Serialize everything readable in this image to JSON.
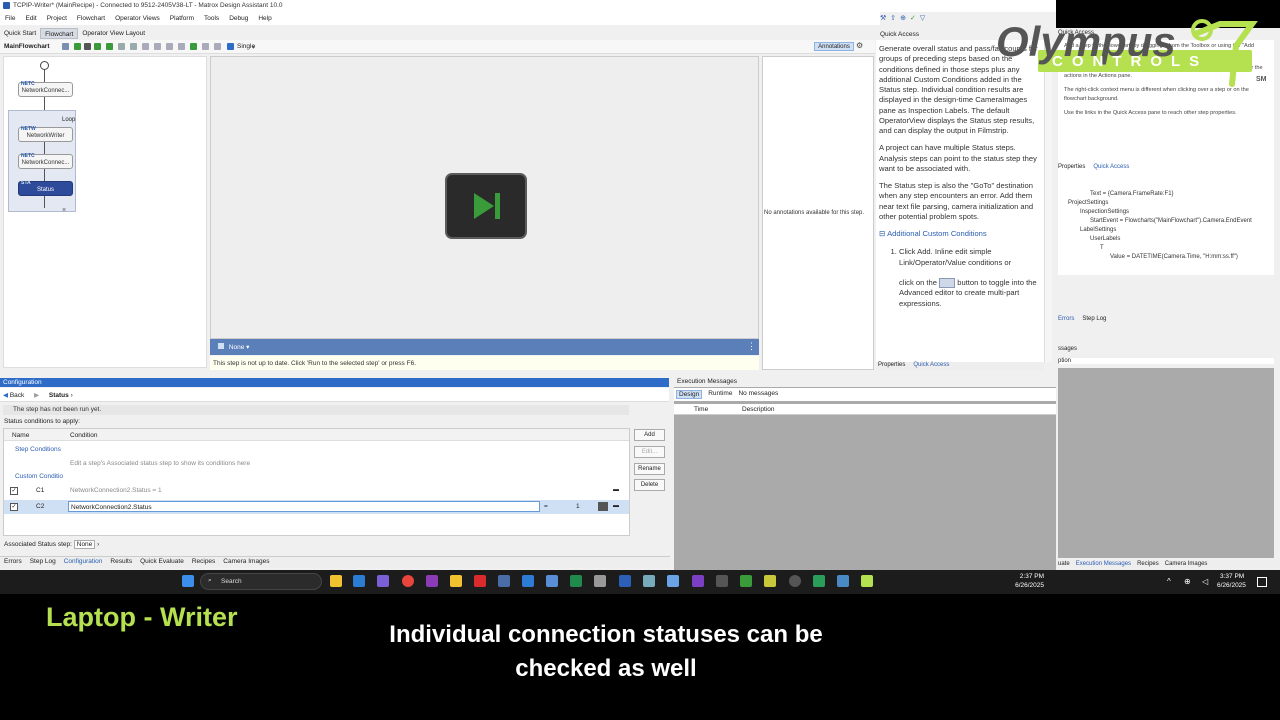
{
  "titlebar": {
    "title": "TCPIP-Writer* (MainRecipe) - Connected to 9512-2405V38-LT - Matrox Design Assistant 10.0"
  },
  "menu": [
    "File",
    "Edit",
    "Project",
    "Flowchart",
    "Operator Views",
    "Platform",
    "Tools",
    "Debug",
    "Help"
  ],
  "tabs": [
    "Quick Start",
    "Flowchart",
    "Operator View Layout"
  ],
  "flowchart": {
    "name": "MainFlowchart",
    "mode": "Single",
    "annotations": "Annotations",
    "nodes": {
      "n1": "NetworkConnec...",
      "n1tag": "NETC",
      "n2": "NetworkWriter",
      "n2tag": "NETW",
      "n3": "NetworkConnec...",
      "n3tag": "NETC",
      "n4": "Status",
      "n4tag": "STA"
    },
    "loop": "Loop"
  },
  "canvas": {
    "image_selector": "None",
    "status_message": "This step is not up to date. Click 'Run to the selected step' or press F6.",
    "annotations_empty": "No annotations available for this step."
  },
  "quick_access": {
    "title": "Quick Access",
    "p1": "Generate overall status and pass/fail counts for groups of preceding steps based on the conditions defined in those steps plus any additional Custom Conditions added in the Status step. Individual condition results are displayed in the design-time CameraImages pane as Inspection Labels. The default OperatorView displays the Status step results, and can display the output in Filmstrip.",
    "p2": "A project can have multiple Status steps. Analysis steps can point to the status step they want to be associated with.",
    "p3": "The Status step is also the \"GoTo\" destination when any step encounters an error. Add them near text file parsing, camera initialization and other potential problem spots.",
    "section": "Additional Custom Conditions",
    "item1a": "Click Add. Inline edit simple Link/Operator/Value conditions or",
    "item1b": "click on the",
    "item1c": "button to toggle into the Advanced editor to create multi-part expressions.",
    "tabs": [
      "Properties",
      "Quick Access"
    ]
  },
  "configuration": {
    "title": "Configuration",
    "back": "Back",
    "step": "Status",
    "not_run": "The step has not been run yet.",
    "conditions_label": "Status conditions to apply:",
    "columns": [
      "Name",
      "Condition"
    ],
    "step_conditions": "Step Conditions",
    "step_hint": "Edit a step's Associated status step to show its conditions here",
    "custom_conditions": "Custom Conditio",
    "rows": [
      {
        "name": "C1",
        "condition": "NetworkConnection2.Status  =  1"
      },
      {
        "name": "C2",
        "condition": "NetworkConnection2.Status",
        "op": "=",
        "value": "1"
      }
    ],
    "buttons": [
      "Add",
      "Edit...",
      "Rename",
      "Delete"
    ],
    "assoc_label": "Associated Status step:",
    "assoc_value": "None"
  },
  "bottom_tabs": [
    "Errors",
    "Step Log",
    "Configuration",
    "Results",
    "Quick Evaluate",
    "Recipes",
    "Camera Images"
  ],
  "exec": {
    "title": "Execution Messages",
    "tabs": [
      "Design",
      "Runtime"
    ],
    "no_messages": "No messages",
    "columns": [
      "Time",
      "Description"
    ]
  },
  "right": {
    "title": "Quick Access",
    "text1": "Add a step to the flowchart, by dragging it from the Toolbox or using the \"Add step\" action. Alternatively, double-click on the ...",
    "text2": "The flowchart can be edited by using standard shortcuts (cut, copy, paste) or the actions in the Actions pane.",
    "text3": "The right-click context menu is different when clicking over a step or on the flowchart background.",
    "text4": "Use the links in the Quick Access pane to reach other step properties.",
    "tabs": [
      "Properties",
      "Quick Access"
    ],
    "tree": [
      "Text = {Camera.FrameRate:F1}",
      "ProjectSettings",
      "InspectionSettings",
      "StartEvent = Flowcharts(\"MainFlowchart\").Camera.EndEvent",
      "LabelSettings",
      "UserLabels",
      "T",
      "Value = DATETIME(Camera.Time, \"H:mm:ss.ff\")"
    ],
    "errtabs": [
      "Errors",
      "Step Log"
    ],
    "msgs": "ssages",
    "col": "ption",
    "bottom": [
      "uate",
      "Execution Messages",
      "Recipes",
      "Camera Images"
    ]
  },
  "taskbar": {
    "search": "Search",
    "time": "2:37 PM",
    "date": "6/26/2025",
    "time2": "3:37 PM",
    "date2": "6/26/2025"
  },
  "logo": {
    "brand": "Olympus",
    "sub": "CONTROLS",
    "sm": "SM"
  },
  "overlay": {
    "speaker": "Laptop - Writer",
    "caption": "Individual connection statuses can be checked as well"
  },
  "colors": {
    "accent": "#2f6cc7",
    "brand_green": "#b5e04f",
    "play_green": "#3a9b3a"
  }
}
